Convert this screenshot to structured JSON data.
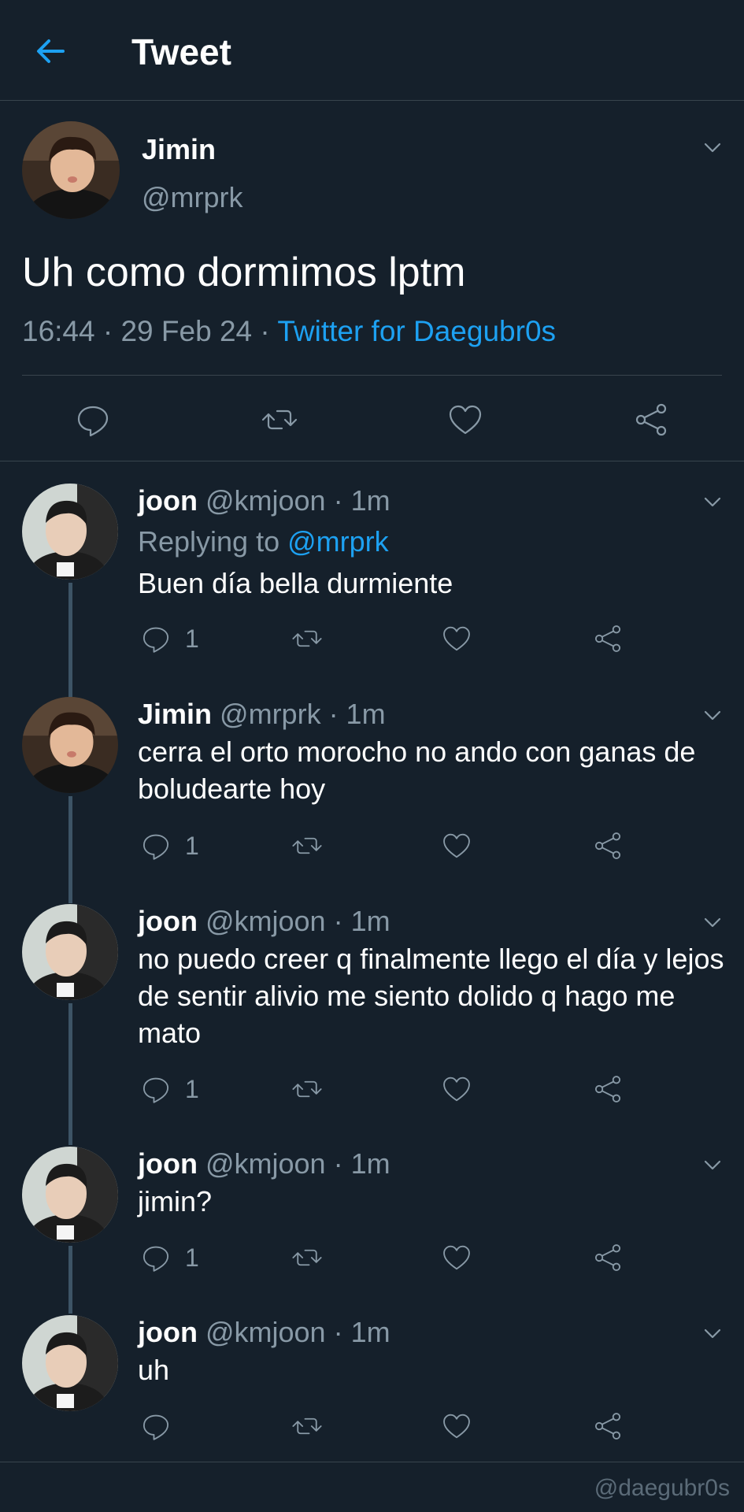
{
  "header": {
    "title": "Tweet",
    "back_icon": "arrow-left-icon"
  },
  "main_tweet": {
    "name": "Jimin",
    "handle": "@mrprk",
    "text": "Uh como dormimos lptm",
    "time": "16:44 · 29 Feb 24 · ",
    "source": "Twitter for Daegubr0s"
  },
  "replies": [
    {
      "name": "joon",
      "meta": " @kmjoon · 1m",
      "replying_prefix": "Replying to ",
      "replying_to": "@mrprk",
      "text": "Buen día bella durmiente",
      "reply_count": "1"
    },
    {
      "name": "Jimin",
      "meta": " @mrprk · 1m",
      "text": "cerra el orto morocho no ando con ganas de boludearte hoy",
      "reply_count": "1"
    },
    {
      "name": "joon",
      "meta": " @kmjoon · 1m",
      "text": "no puedo creer q finalmente llego el día y lejos de sentir alivio me siento dolido q hago me mato",
      "reply_count": "1"
    },
    {
      "name": "joon",
      "meta": " @kmjoon · 1m",
      "text": "jimin?",
      "reply_count": "1"
    },
    {
      "name": "joon",
      "meta": " @kmjoon · 1m",
      "text": "uh",
      "reply_count": ""
    }
  ],
  "watermark": "@daegubr0s",
  "colors": {
    "background": "#15202b",
    "accent": "#1da1f2",
    "muted": "#8899a6",
    "divider": "#38444d"
  }
}
